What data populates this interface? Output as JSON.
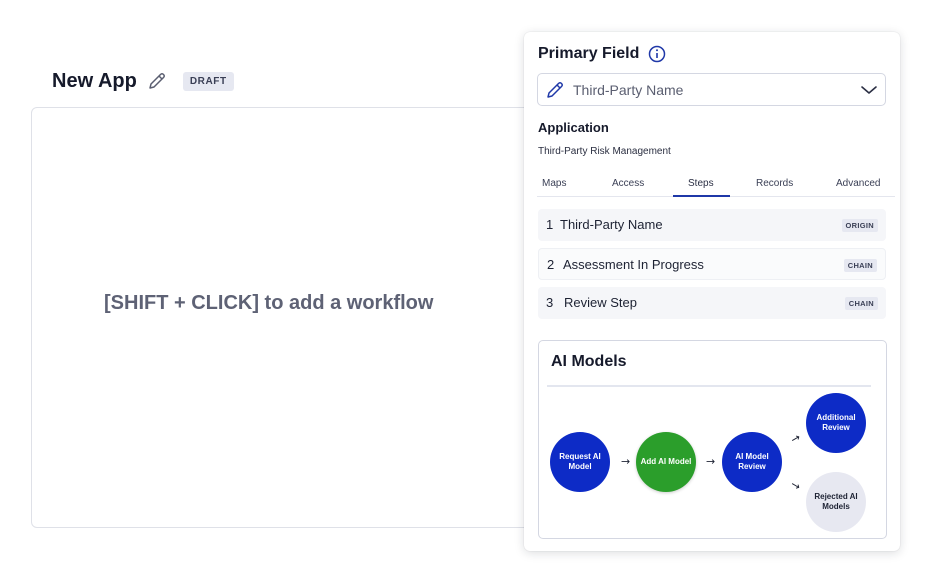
{
  "header": {
    "title": "New App",
    "badge": "DRAFT"
  },
  "canvas": {
    "hint": "[SHIFT + CLICK] to add a workflow"
  },
  "panel": {
    "title": "Primary Field",
    "primary_field": {
      "value": "Third-Party Name"
    },
    "application_label": "Application",
    "application_name": "Third-Party Risk Management",
    "tabs": [
      {
        "label": "Maps"
      },
      {
        "label": "Access"
      },
      {
        "label": "Steps",
        "active": true
      },
      {
        "label": "Records"
      },
      {
        "label": "Advanced"
      }
    ],
    "steps": [
      {
        "num": "1",
        "label": "Third-Party Name",
        "badge": "ORIGIN"
      },
      {
        "num": "2",
        "label": "Assessment In Progress",
        "badge": "CHAIN"
      },
      {
        "num": "3",
        "label": "Review Step",
        "badge": "CHAIN"
      }
    ]
  },
  "models": {
    "title": "AI Models",
    "nodes": {
      "request": "Request AI Model",
      "add": "Add AI Model",
      "review": "AI Model Review",
      "additional": "Additional Review",
      "rejected": "Rejected AI Models"
    },
    "arrow_glyph": "→"
  },
  "colors": {
    "accent": "#1f38a8",
    "node_blue": "#0d2bc6",
    "node_green": "#2b9e2b",
    "node_grey": "#e7e8f1"
  }
}
